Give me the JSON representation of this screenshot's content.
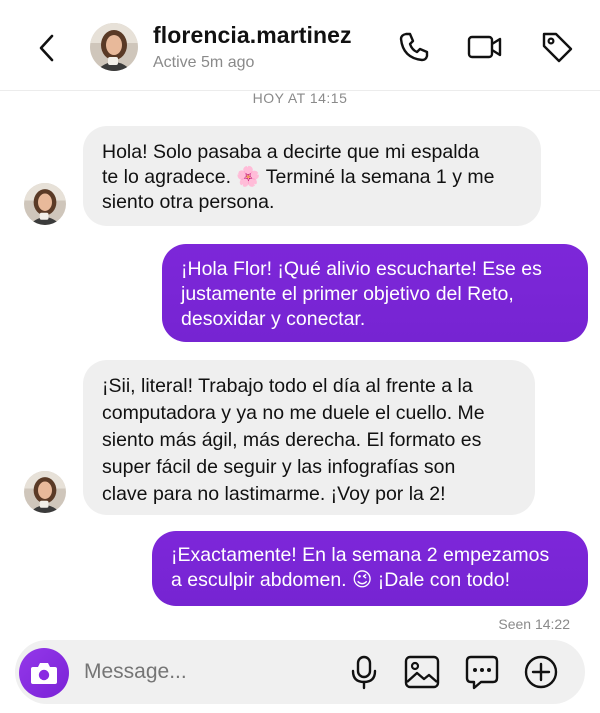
{
  "header": {
    "username": "florencia.martinez",
    "status": "Active 5m ago",
    "icons": [
      "back-arrow-icon",
      "phone-icon",
      "video-icon",
      "tag-icon"
    ]
  },
  "timestamp": "HOY AT 14:15",
  "messages": [
    {
      "from": "them",
      "text": "Hola! Solo pasaba a decirte que mi espalda\nte lo agradece. 🌸 Terminé la semana 1 y me\nsiento otra persona."
    },
    {
      "from": "me",
      "text": "¡Hola Flor! ¡Qué alivio escucharte! Ese es\njustamente el primer objetivo del Reto,\ndesoxidar y conectar."
    },
    {
      "from": "them",
      "text": "¡Sii, literal! Trabajo todo el día al frente a la\ncomputadora y ya no me duele el cuello. Me\nsiento más ágil, más derecha. El formato es\nsuper fácil de seguir y las infografías son\nclave para no lastimarme. ¡Voy por la 2!"
    },
    {
      "from": "me",
      "text": "¡Exactamente! En la semana 2 empezamos\na esculpir abdomen. 😉 ¡Dale con todo!"
    }
  ],
  "seen": "Seen 14:22",
  "composer": {
    "placeholder": "Message...",
    "icons": [
      "camera-icon",
      "microphone-icon",
      "image-icon",
      "sticker-icon",
      "plus-icon"
    ]
  },
  "colors": {
    "outgoing_bubble": "#7a25d8",
    "incoming_bubble": "#efefef",
    "camera_button": "#8a2be2"
  }
}
